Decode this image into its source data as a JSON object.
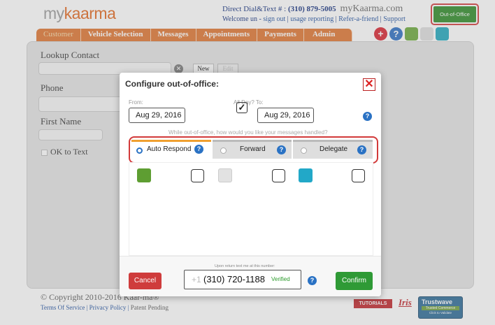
{
  "header": {
    "logo_my": "my",
    "logo_brand": "kaarma",
    "dial_label": "Direct Dial&Text # :",
    "dial_number": "(310) 879-5005",
    "brand_text": "myKaarma.com",
    "welcome": "Welcome un -",
    "sign_out": "sign out",
    "usage_reporting": "usage reporting",
    "refer": "Refer-a-friend",
    "support": "Support",
    "out_of_office": "Out-of-Office"
  },
  "nav": {
    "tabs": [
      "Customer",
      "Vehicle Selection",
      "Messages",
      "Appointments",
      "Payments",
      "Admin"
    ]
  },
  "nav_icons": [
    "add-icon",
    "help-icon",
    "text-icon",
    "email-icon",
    "phone-icon"
  ],
  "form": {
    "lookup_label": "Lookup Contact",
    "new_label": "New",
    "edit_label": "Edit",
    "phone_label": "Phone",
    "first_name_label": "First Name",
    "ok_to_text": "OK to Text"
  },
  "footer": {
    "copyright": "© Copyright 2010-2016 Kaar-ma®",
    "terms": "Terms Of Service",
    "privacy": "Privacy Policy",
    "patent": "Patent Pending",
    "tutorials": "TUTORIALS",
    "iris": "Iris",
    "trust_title": "Trustwave",
    "trust_sub": "Trusted Commerce",
    "trust_validate": "Click to Validate"
  },
  "modal": {
    "title": "Configure out-of-office:",
    "from_label": "From:",
    "from_date": "Aug 29, 2016",
    "all_day_label": "All Day? To:",
    "all_day_checked": true,
    "to_date": "Aug 29, 2016",
    "question": "While out-of-office, how would you like your messages handled?",
    "tabs": [
      {
        "label": "Auto Respond",
        "selected": true
      },
      {
        "label": "Forward",
        "selected": false
      },
      {
        "label": "Delegate",
        "selected": false
      }
    ],
    "channels": [
      "text-channel",
      "email-channel",
      "phone-channel"
    ],
    "cancel": "Cancel",
    "return_label": "Upon return text me at this number:",
    "country_code": "+1",
    "return_number": "(310) 720-1188",
    "verified": "Verified",
    "confirm": "Confirm"
  },
  "colors": {
    "accent_orange": "#e0742f",
    "highlight_red": "#d23a3a",
    "confirm_green": "#2f9a36",
    "cancel_red": "#cf3c3c",
    "help_blue": "#2a72c4"
  }
}
